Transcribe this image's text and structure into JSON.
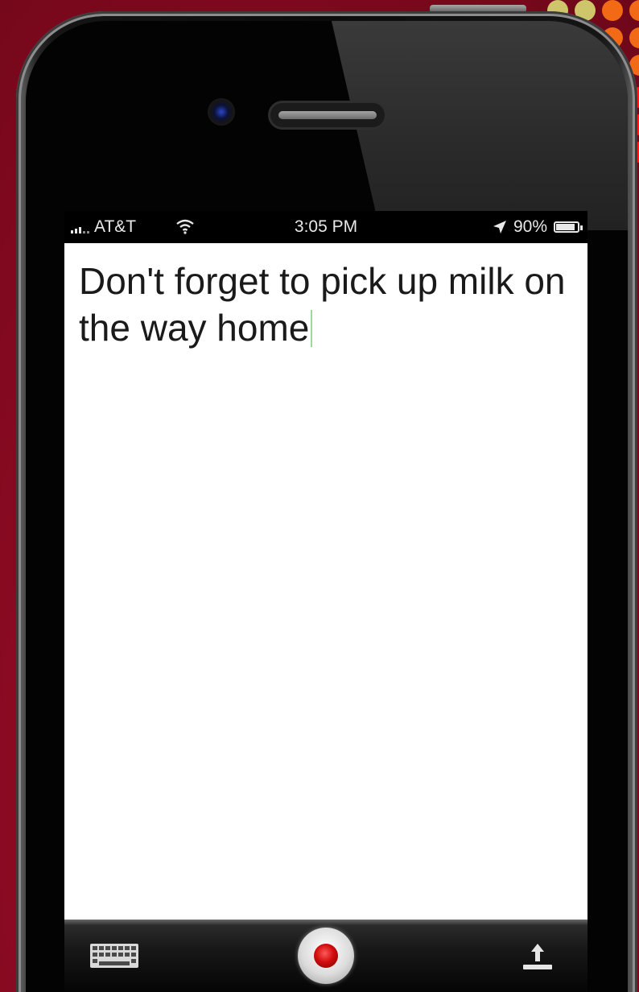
{
  "status_bar": {
    "carrier": "AT&T",
    "time": "3:05 PM",
    "battery": "90%",
    "battery_level": 0.9,
    "icons": [
      "signal-icon",
      "wifi-icon",
      "location-arrow-icon",
      "battery-icon"
    ]
  },
  "note": {
    "text": "Don't forget to pick up milk on the way home"
  },
  "toolbar": {
    "icons": [
      "keyboard-icon",
      "record-icon",
      "share-icon"
    ]
  },
  "colors": {
    "background": "#8a0a22",
    "record_red": "#d10d0d",
    "screen": "#ffffff"
  }
}
